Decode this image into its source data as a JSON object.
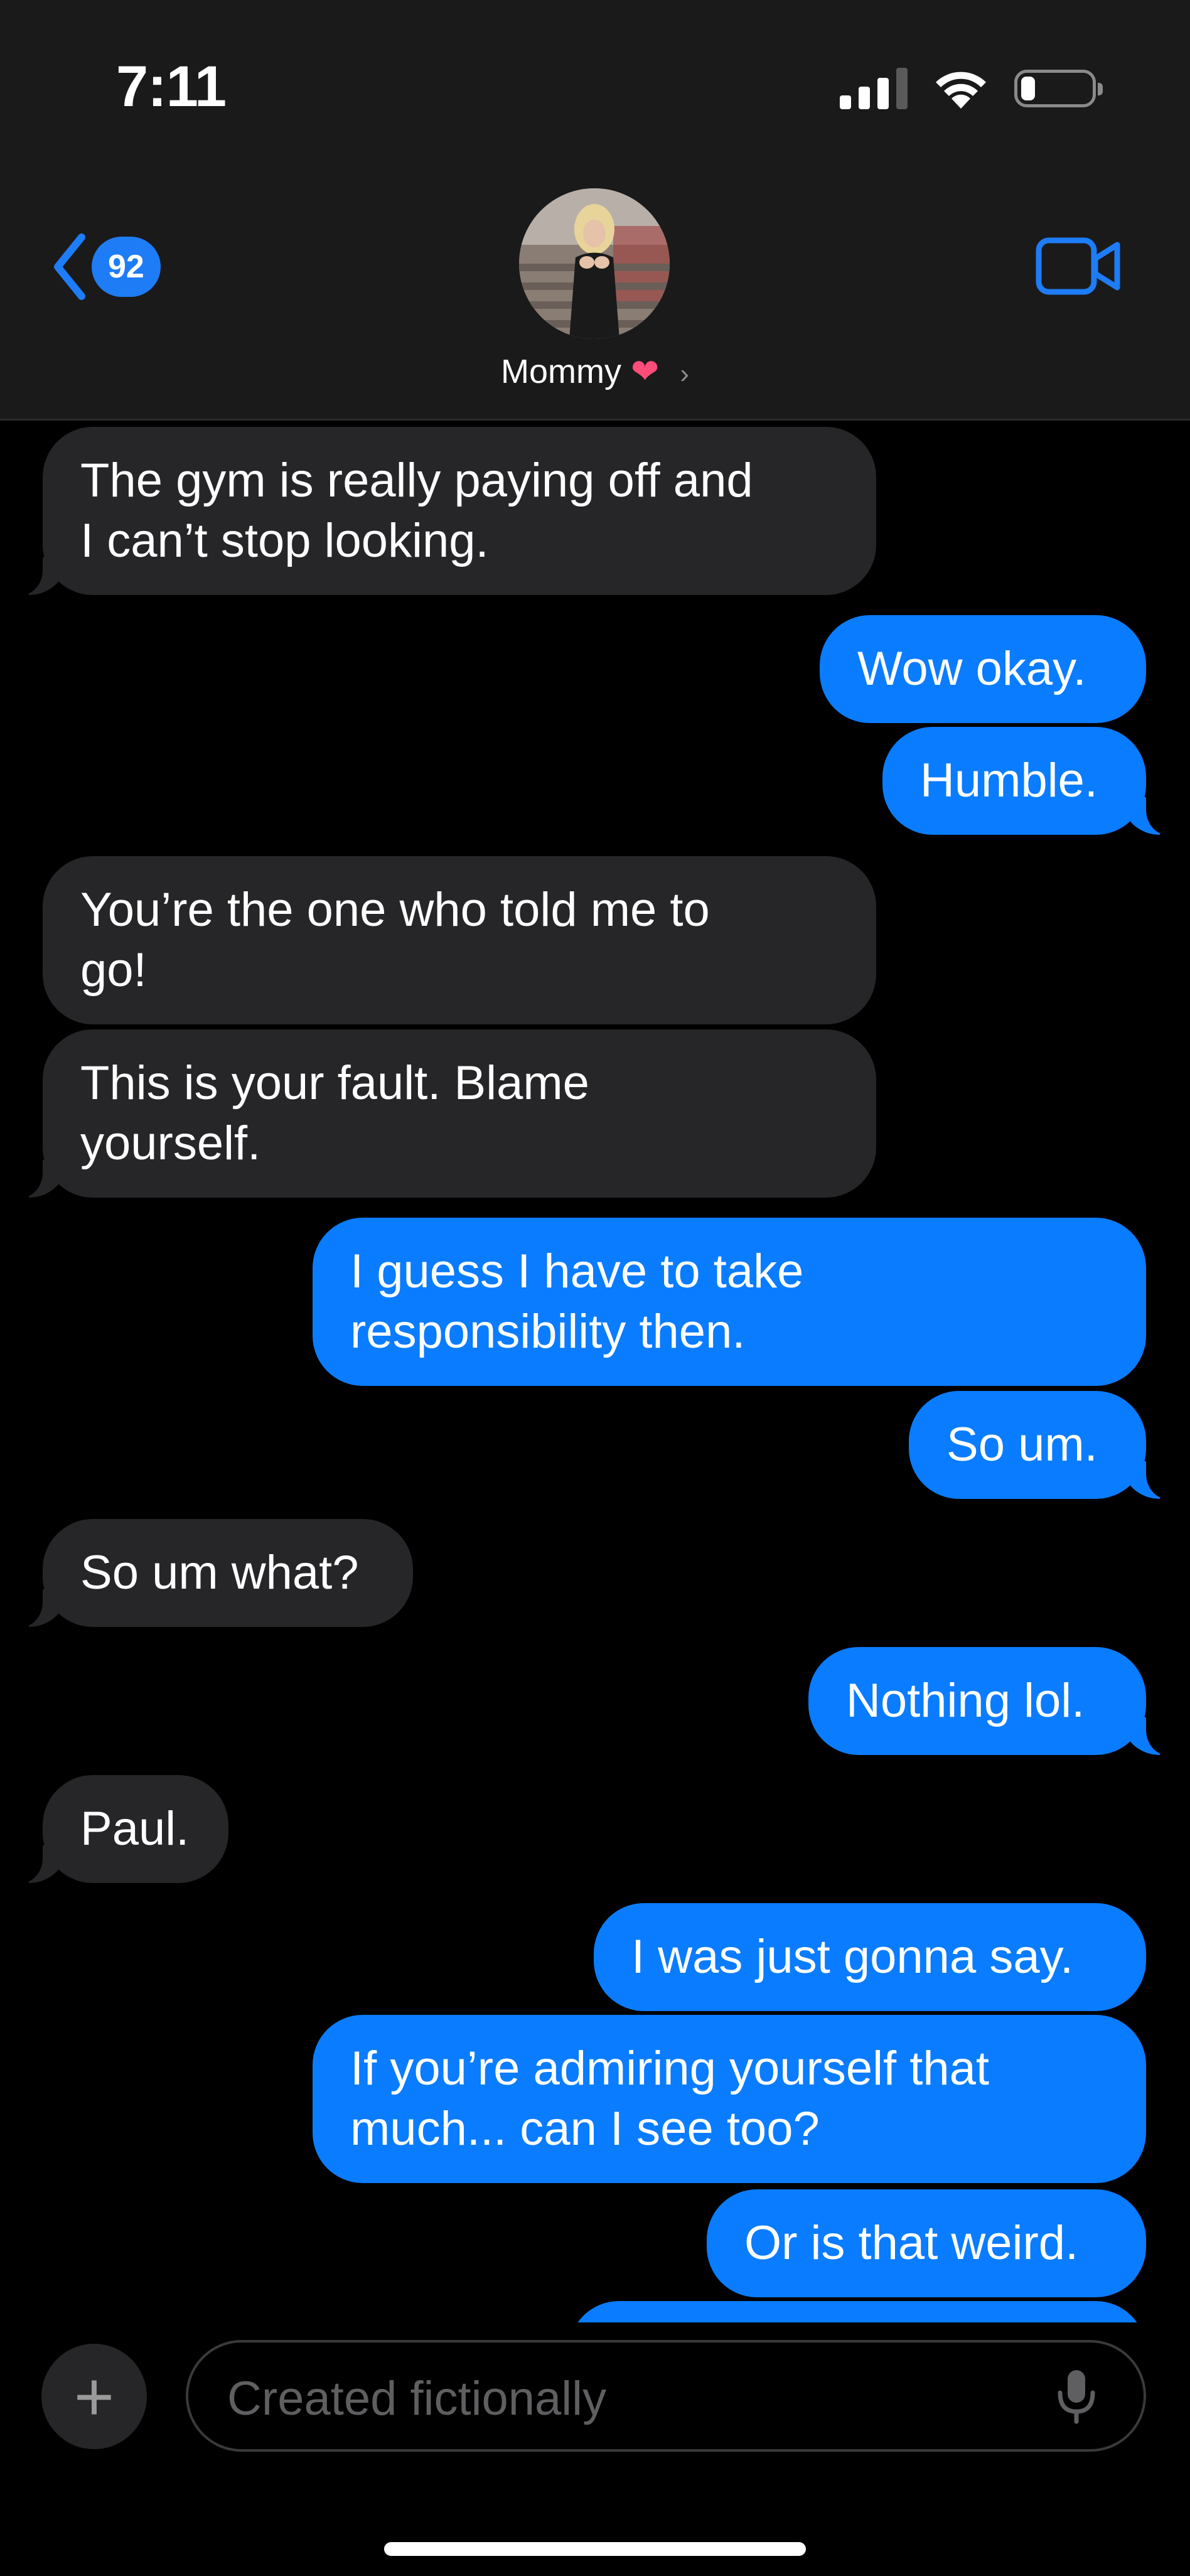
{
  "status_bar": {
    "time": "7:11"
  },
  "header": {
    "back_count": "92",
    "contact_name": "Mommy",
    "contact_emoji": "❤",
    "chevron": "›"
  },
  "messages": [
    {
      "side": "in",
      "text": "The gym is really paying off and\nI can’t stop looking."
    },
    {
      "side": "out",
      "text": "Wow okay."
    },
    {
      "side": "out",
      "text": "Humble."
    },
    {
      "side": "in",
      "text": "You’re the one who told me to\ngo!"
    },
    {
      "side": "in",
      "text": "This is your fault. Blame\nyourself."
    },
    {
      "side": "out",
      "text": "I guess I have to take\nresponsibility then."
    },
    {
      "side": "out",
      "text": "So um."
    },
    {
      "side": "in",
      "text": "So um what?"
    },
    {
      "side": "out",
      "text": "Nothing lol."
    },
    {
      "side": "in",
      "text": "Paul."
    },
    {
      "side": "out",
      "text": "I was just gonna say."
    },
    {
      "side": "out",
      "text": "If you’re admiring yourself that\nmuch... can I see too?"
    },
    {
      "side": "out",
      "text": "Or is that weird."
    }
  ],
  "composer": {
    "placeholder": "Created fictionally"
  },
  "icons": [
    "back-chevron-icon",
    "video-camera-icon",
    "plus-icon",
    "microphone-icon",
    "wifi-icon",
    "battery-icon",
    "signal-icon",
    "heart-icon"
  ]
}
